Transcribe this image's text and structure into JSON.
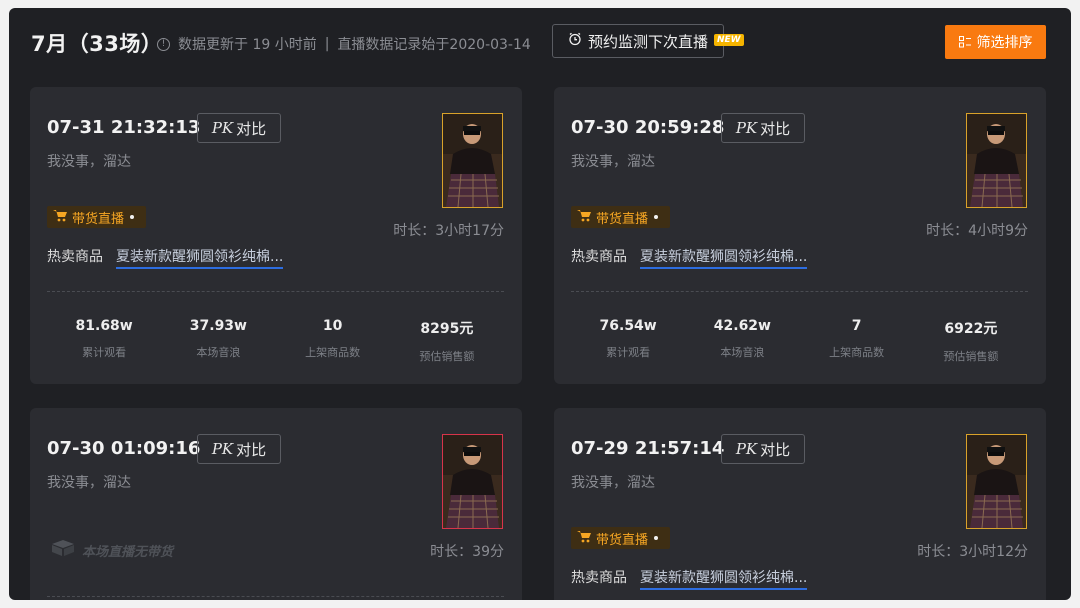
{
  "header": {
    "month_title": "7月（33场）",
    "update_info": "数据更新于 19 小时前",
    "separator": "|",
    "record_info": "直播数据记录始于2020-03-14",
    "reserve_button": "预约监测下次直播",
    "new_badge": "NEW",
    "filter_button": "筛选排序"
  },
  "common": {
    "pk_prefix": "PK",
    "pk_label": "对比",
    "hot_label": "热卖商品",
    "live_tag": "带货直播",
    "no_goods_text": "本场直播无带货"
  },
  "cards": [
    {
      "datetime": "07-31 21:32:13",
      "streamer": "我没事，溜达",
      "duration": "时长：3小时17分",
      "hot_product": "夏装新款醒狮圆领衫纯棉...",
      "stats": [
        {
          "value": "81.68w",
          "label": "累计观看"
        },
        {
          "value": "37.93w",
          "label": "本场音浪"
        },
        {
          "value": "10",
          "label": "上架商品数"
        },
        {
          "value": "8295元",
          "label": "预估销售额"
        }
      ]
    },
    {
      "datetime": "07-30 20:59:28",
      "streamer": "我没事，溜达",
      "duration": "时长：4小时9分",
      "hot_product": "夏装新款醒狮圆领衫纯棉...",
      "stats": [
        {
          "value": "76.54w",
          "label": "累计观看"
        },
        {
          "value": "42.62w",
          "label": "本场音浪"
        },
        {
          "value": "7",
          "label": "上架商品数"
        },
        {
          "value": "6922元",
          "label": "预估销售额"
        }
      ]
    },
    {
      "datetime": "07-30 01:09:16",
      "streamer": "我没事，溜达",
      "duration": "时长：39分"
    },
    {
      "datetime": "07-29 21:57:14",
      "streamer": "我没事，溜达",
      "duration": "时长：3小时12分",
      "hot_product": "夏装新款醒狮圆领衫纯棉..."
    }
  ],
  "colors": {
    "accent_orange": "#f97a10",
    "tag_orange": "#f6a623",
    "link_underline": "#2d6de0",
    "thumb_border_yellow": "#d9a22a",
    "thumb_border_red": "#d7344a"
  }
}
